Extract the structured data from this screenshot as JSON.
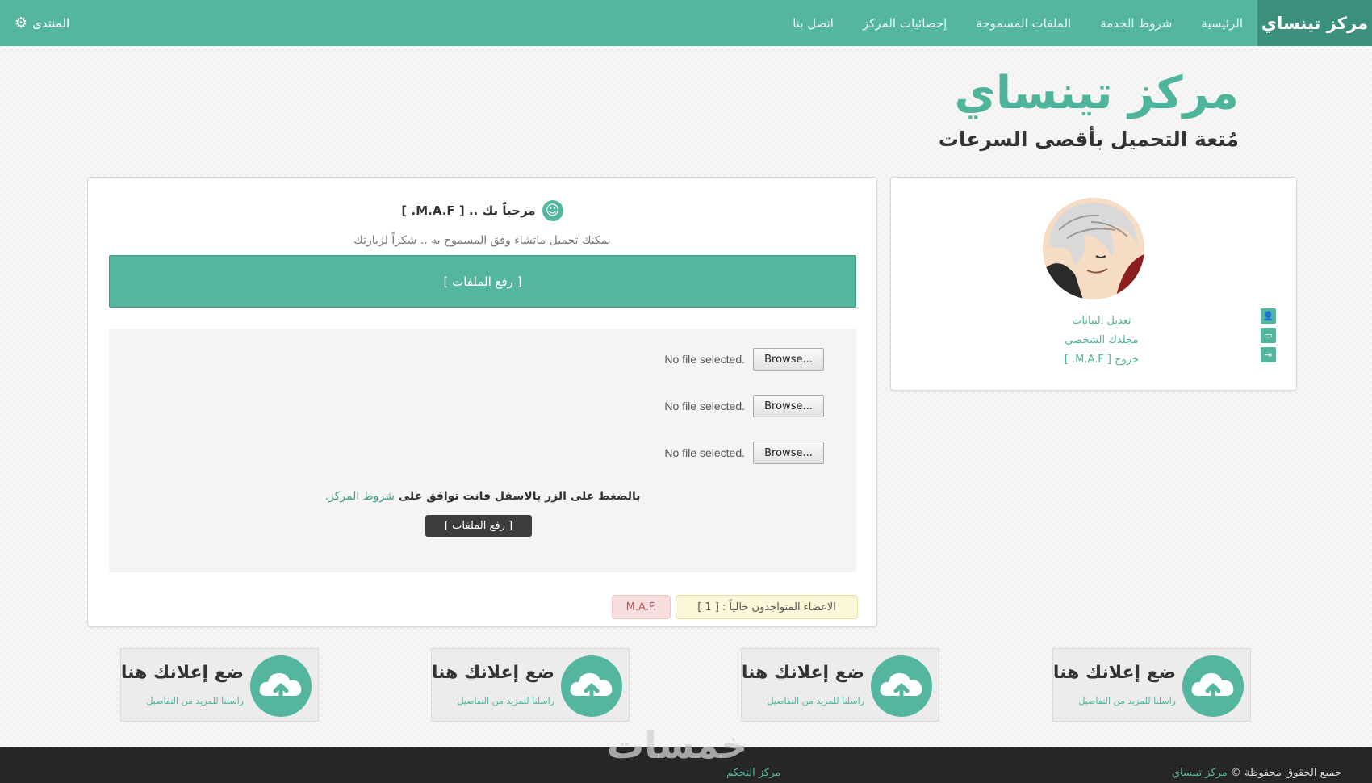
{
  "nav": {
    "brand": "مركز تينساي",
    "links": [
      "الرئيسية",
      "شروط الخدمة",
      "الملفات المسموحة",
      "إحصائيات المركز",
      "اتصل بنا"
    ],
    "forum_label": "المنتدى",
    "forum_icon": "gear-icon"
  },
  "header": {
    "title": "مركز تينساي",
    "subtitle": "مُتعة التحميل بأقصى السرعات"
  },
  "main": {
    "welcome": "مرحباً بك .. [ M.A.F. ]",
    "welcome_icon": "smiley-icon",
    "note": "يمكنك تحميل ماتشاء وفق المسموح به .. شكراً لزيارتك",
    "upload_bar": "[ رفع الملفات ]",
    "file_inputs": [
      {
        "button": "Browse...",
        "status": "No file selected."
      },
      {
        "button": "Browse...",
        "status": "No file selected."
      },
      {
        "button": "Browse...",
        "status": "No file selected."
      }
    ],
    "terms_text": "بالضغط على الزر بالاسفل فانت توافق على",
    "terms_link": "شروط المركز.",
    "submit_label": "[ رفع الملفات ]",
    "online_label": "الاعضاء المتواجدون حالياً : [ 1 ]",
    "online_user": "M.A.F."
  },
  "sidebar": {
    "links": [
      "تعديل البيانات",
      "مجلدك الشخصي",
      "خروج [ M.A.F. ]"
    ],
    "icons": [
      "user-icon",
      "folder-icon",
      "logout-icon"
    ]
  },
  "ads": {
    "title": "ضع إعلانك هنا",
    "subtitle": "راسلنا للمزيد من التفاصيل",
    "icon": "cloud-upload-icon",
    "count": 4
  },
  "footer": {
    "copyright_prefix": "جميع الحقوق محفوظة ©",
    "copyright_link": "مركز تينساي",
    "control_link": "مركز التحكم"
  },
  "watermark": "خمسات",
  "colors": {
    "accent": "#55b6a0",
    "accent_dark": "#3b8f7d",
    "footer_bg": "#262626"
  }
}
